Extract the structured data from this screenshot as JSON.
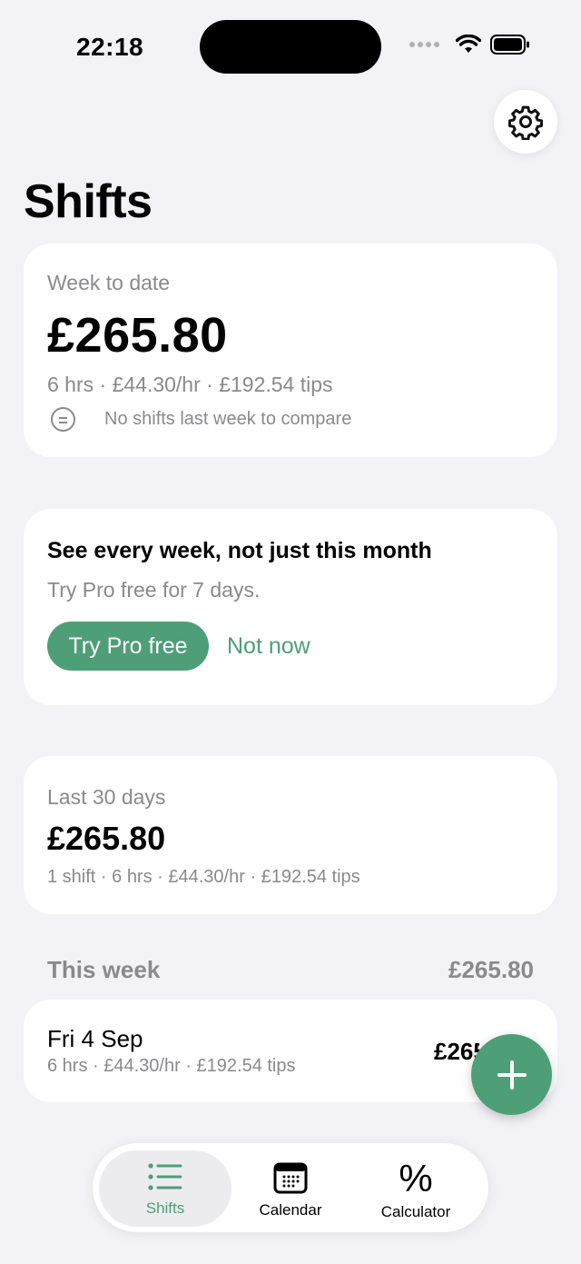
{
  "status_bar": {
    "time": "22:18"
  },
  "header": {
    "title": "Shifts"
  },
  "week_card": {
    "label": "Week to date",
    "amount": "£265.80",
    "stats": "6 hrs · £44.30/hr · £192.54 tips",
    "compare": "No shifts last week to compare"
  },
  "promo_card": {
    "title": "See every week, not just this month",
    "subtitle": "Try Pro free for 7 days.",
    "cta_label": "Try Pro free",
    "dismiss_label": "Not now"
  },
  "last30_card": {
    "label": "Last 30 days",
    "amount": "£265.80",
    "stats": "1 shift · 6 hrs · £44.30/hr · £192.54 tips"
  },
  "this_week": {
    "title": "This week",
    "total": "£265.80",
    "shifts": [
      {
        "date": "Fri 4 Sep",
        "stats": "6 hrs · £44.30/hr · £192.54 tips",
        "amount": "£265.80"
      }
    ]
  },
  "tab_bar": {
    "tabs": [
      {
        "label": "Shifts",
        "icon": "list-icon",
        "active": true
      },
      {
        "label": "Calendar",
        "icon": "calendar-icon",
        "active": false
      },
      {
        "label": "Calculator",
        "icon": "percent-icon",
        "active": false
      }
    ]
  },
  "colors": {
    "accent": "#4e9e78",
    "background": "#f2f2f7",
    "muted_text": "#8a8a8e"
  }
}
